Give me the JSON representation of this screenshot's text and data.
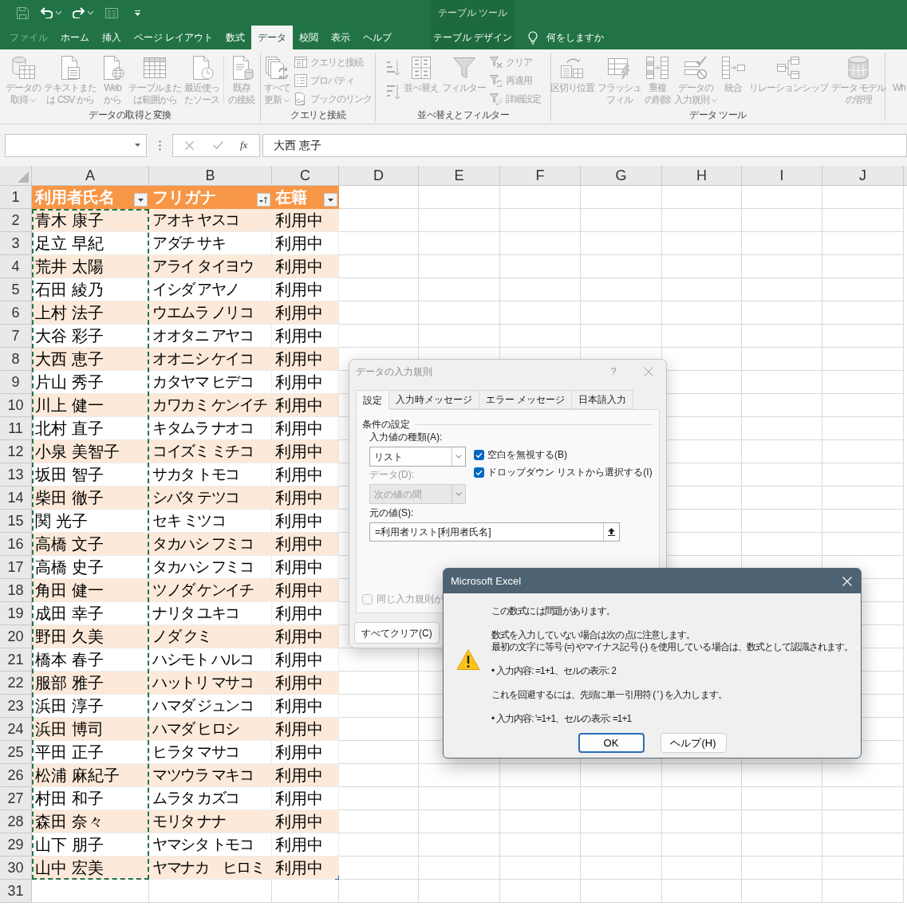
{
  "tabs": [
    {
      "label": "ファイル",
      "selected": false,
      "disabled": true
    },
    {
      "label": "ホーム",
      "selected": false,
      "disabled": false
    },
    {
      "label": "挿入",
      "selected": false,
      "disabled": false
    },
    {
      "label": "ページ レイアウト",
      "selected": false,
      "disabled": false
    },
    {
      "label": "数式",
      "selected": false,
      "disabled": false
    },
    {
      "label": "データ",
      "selected": true,
      "disabled": false
    },
    {
      "label": "校閲",
      "selected": false,
      "disabled": false
    },
    {
      "label": "表示",
      "selected": false,
      "disabled": false
    },
    {
      "label": "ヘルプ",
      "selected": false,
      "disabled": false
    }
  ],
  "contextual_tab_group": {
    "label": "テーブル ツール",
    "tabs": [
      {
        "label": "テーブル デザイン",
        "selected": false,
        "disabled": false
      }
    ]
  },
  "tell_me": {
    "label": "何をしますか"
  },
  "ribbon": {
    "disabled": true,
    "groups": [
      {
        "label": "データの取得と変換",
        "items": [
          {
            "kind": "large",
            "lines": [
              "データの",
              "取得"
            ],
            "dropdown": true
          },
          {
            "kind": "large",
            "lines": [
              "テキストまた",
              "は CSV から"
            ],
            "dropdown": false
          },
          {
            "kind": "large",
            "lines": [
              "Web",
              "から"
            ],
            "dropdown": false
          },
          {
            "kind": "large",
            "lines": [
              "テーブルまた",
              "は範囲から"
            ],
            "dropdown": false
          },
          {
            "kind": "large",
            "lines": [
              "最近使っ",
              "たソース"
            ],
            "dropdown": false
          },
          {
            "kind": "separator"
          },
          {
            "kind": "large",
            "lines": [
              "既存",
              "の接続"
            ],
            "dropdown": false
          }
        ]
      },
      {
        "label": "クエリと接続",
        "items": [
          {
            "kind": "large",
            "lines": [
              "すべて",
              "更新"
            ],
            "dropdown": true
          },
          {
            "kind": "stack",
            "items": [
              {
                "kind": "small",
                "label": "クエリと接続"
              },
              {
                "kind": "small",
                "label": "プロパティ"
              },
              {
                "kind": "small",
                "label": "ブックのリンク"
              }
            ]
          }
        ]
      },
      {
        "label": "並べ替えとフィルター",
        "items": [
          {
            "kind": "stack",
            "items": [
              {
                "kind": "sort_ascending"
              },
              {
                "kind": "sort_descending"
              }
            ]
          },
          {
            "kind": "large",
            "lines": [
              "並べ替え"
            ],
            "dropdown": false
          },
          {
            "kind": "large",
            "lines": [
              "フィルター"
            ],
            "dropdown": false
          },
          {
            "kind": "stack",
            "items": [
              {
                "kind": "small",
                "label": "クリア"
              },
              {
                "kind": "small",
                "label": "再適用"
              },
              {
                "kind": "small",
                "label": "詳細設定"
              }
            ]
          }
        ]
      },
      {
        "label": "データ ツール",
        "items": [
          {
            "kind": "large",
            "lines": [
              "区切り位置"
            ],
            "dropdown": false
          },
          {
            "kind": "large",
            "lines": [
              "フラッシュ",
              "フィル"
            ],
            "dropdown": false
          },
          {
            "kind": "large",
            "lines": [
              "重複",
              "の削除"
            ],
            "dropdown": false
          },
          {
            "kind": "large",
            "lines": [
              "データの",
              "入力規則"
            ],
            "dropdown": true
          },
          {
            "kind": "large",
            "lines": [
              "統合"
            ],
            "dropdown": false
          },
          {
            "kind": "large",
            "lines": [
              "リレーションシップ"
            ],
            "dropdown": false
          },
          {
            "kind": "large",
            "lines": [
              "データ モデル",
              "の管理"
            ],
            "dropdown": false
          }
        ]
      },
      {
        "items": [
          {
            "kind": "large",
            "lines": [
              "Wh"
            ]
          }
        ]
      }
    ]
  },
  "formula_bar": {
    "insert_function": "fx",
    "value": "大西 恵子"
  },
  "sheet": {
    "column_letters": [
      "A",
      "B",
      "C",
      "D",
      "E",
      "F",
      "G",
      "H",
      "I",
      "J"
    ],
    "row_numbers": [
      "1",
      "2",
      "3",
      "4",
      "5",
      "6",
      "7",
      "8",
      "9",
      "10",
      "11",
      "12",
      "13",
      "14",
      "15",
      "16",
      "17",
      "18",
      "19",
      "20",
      "21",
      "22",
      "23",
      "24",
      "25",
      "26",
      "27",
      "28",
      "29",
      "30",
      "31"
    ],
    "table": {
      "columns": [
        {
          "label": "利用者氏名",
          "sorted": false,
          "copied": true
        },
        {
          "label": "フリガナ",
          "sorted": true,
          "copied": false
        },
        {
          "label": "在籍",
          "sorted": false,
          "copied": false
        }
      ],
      "rows": [
        [
          "青木 康子",
          "アオキ ヤスコ",
          "利用中"
        ],
        [
          "足立 早紀",
          "アダチ サキ",
          "利用中"
        ],
        [
          "荒井 太陽",
          "アライ タイヨウ",
          "利用中"
        ],
        [
          "石田 綾乃",
          "イシダ アヤノ",
          "利用中"
        ],
        [
          "上村 法子",
          "ウエムラ ノリコ",
          "利用中"
        ],
        [
          "大谷 彩子",
          "オオタニ アヤコ",
          "利用中"
        ],
        [
          "大西 恵子",
          "オオニシ ケイコ",
          "利用中"
        ],
        [
          "片山 秀子",
          "カタヤマ ヒデコ",
          "利用中"
        ],
        [
          "川上 健一",
          "カワカミ ケンイチ",
          "利用中"
        ],
        [
          "北村 直子",
          "キタムラ ナオコ",
          "利用中"
        ],
        [
          "小泉 美智子",
          "コイズミ ミチコ",
          "利用中"
        ],
        [
          "坂田 智子",
          "サカタ トモコ",
          "利用中"
        ],
        [
          "柴田 徹子",
          "シバタ テツコ",
          "利用中"
        ],
        [
          "関 光子",
          "セキ ミツコ",
          "利用中"
        ],
        [
          "高橋 文子",
          "タカハシ フミコ",
          "利用中"
        ],
        [
          "高橋 史子",
          "タカハシ フミコ",
          "利用中"
        ],
        [
          "角田 健一",
          "ツノダ ケンイチ",
          "利用中"
        ],
        [
          "成田 幸子",
          "ナリタ ユキコ",
          "利用中"
        ],
        [
          "野田 久美",
          "ノダ クミ",
          "利用中"
        ],
        [
          "橋本 春子",
          "ハシモト ハルコ",
          "利用中"
        ],
        [
          "服部 雅子",
          "ハットリ マサコ",
          "利用中"
        ],
        [
          "浜田 淳子",
          "ハマダ ジュンコ",
          "利用中"
        ],
        [
          "浜田 博司",
          "ハマダ ヒロシ",
          "利用中"
        ],
        [
          "平田 正子",
          "ヒラタ マサコ",
          "利用中"
        ],
        [
          "松浦 麻紀子",
          "マツウラ マキコ",
          "利用中"
        ],
        [
          "村田 和子",
          "ムラタ カズコ",
          "利用中"
        ],
        [
          "森田 奈々",
          "モリタ ナナ",
          "利用中"
        ],
        [
          "山下 朋子",
          "ヤマシタ トモコ",
          "利用中"
        ],
        [
          "山中 宏美",
          "ヤマナカ　ヒロミ",
          "利用中"
        ]
      ]
    }
  },
  "validation_dialog": {
    "title": "データの入力規則",
    "help": "?",
    "tabs": [
      {
        "label": "設定",
        "selected": true
      },
      {
        "label": "入力時メッセージ",
        "selected": false
      },
      {
        "label": "エラー メッセージ",
        "selected": false
      },
      {
        "label": "日本語入力",
        "selected": false
      }
    ],
    "section": "条件の設定",
    "allow": {
      "label": "入力値の種類(A):",
      "value": "リスト",
      "disabled": false
    },
    "options": [
      {
        "label": "空白を無視する(B)",
        "checked": true
      },
      {
        "label": "ドロップダウン リストから選択する(I)",
        "checked": true
      }
    ],
    "data": {
      "label": "データ(D):",
      "value": "次の値の間",
      "disabled": true
    },
    "source": {
      "label": "元の値(S):",
      "value": "=利用者リスト[利用者氏名]"
    },
    "apply_all": {
      "label": "同じ入力規則が",
      "checked": false
    },
    "buttons": [
      "すべてクリア(C)"
    ]
  },
  "error_dialog": {
    "title": "Microsoft Excel",
    "paragraphs": [
      [
        "この数式には問題があります。"
      ],
      [
        "数式を入力していない場合は次の点に注意します。",
        "最初の文字に等号 (=) やマイナス記号 (-) を使用している場合は、数式として認識されます。"
      ],
      [
        "• 入力内容: =1+1、セルの表示: 2"
      ],
      [
        "これを回避するには、先頭に単一引用符 ( ' ) を入力します。"
      ],
      [
        "• 入力内容: '=1+1、セルの表示: =1+1"
      ]
    ],
    "buttons": [
      {
        "label": "OK",
        "default": true
      },
      {
        "label": "ヘルプ(H)",
        "default": false
      }
    ]
  }
}
